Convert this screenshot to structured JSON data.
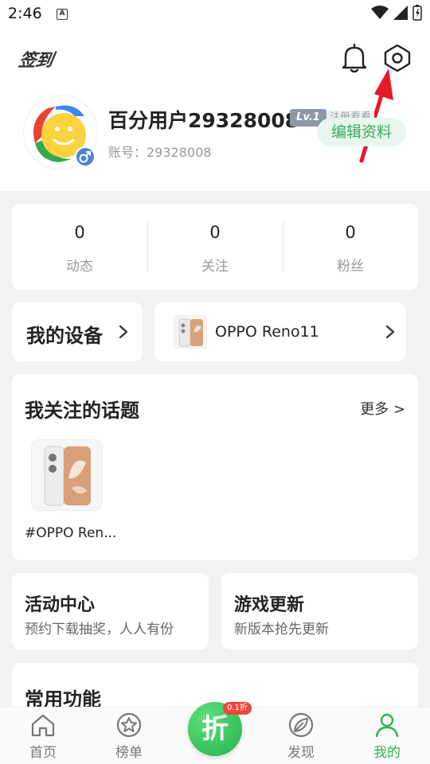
{
  "status": {
    "time": "2:46",
    "notif_icon_letter": "A"
  },
  "header": {
    "signin_label": "签到"
  },
  "profile": {
    "username": "百分用户29328008",
    "level": "Lv.1",
    "register_tag": "注册看看",
    "edit_label": "编辑资料",
    "account": "账号：29328008"
  },
  "stats": [
    {
      "value": "0",
      "label": "动态"
    },
    {
      "value": "0",
      "label": "关注"
    },
    {
      "value": "0",
      "label": "粉丝"
    }
  ],
  "devices": {
    "title": "我的设备",
    "phone_name": "OPPO Reno11"
  },
  "topics": {
    "title": "我关注的话题",
    "more": "更多 >",
    "items": [
      {
        "name": "#OPPO Ren..."
      }
    ]
  },
  "activity": {
    "title": "活动中心",
    "subtitle": "预约下载抽奖，人人有份"
  },
  "games": {
    "title": "游戏更新",
    "subtitle": "新版本抢先更新"
  },
  "functions": {
    "title": "常用功能"
  },
  "tabbar": {
    "home": "首页",
    "rank": "榜单",
    "center": "折",
    "center_badge": "0.1折",
    "discover": "发现",
    "mine": "我的"
  },
  "colors": {
    "accent": "#2eb34e",
    "arrow": "#e8182b"
  }
}
